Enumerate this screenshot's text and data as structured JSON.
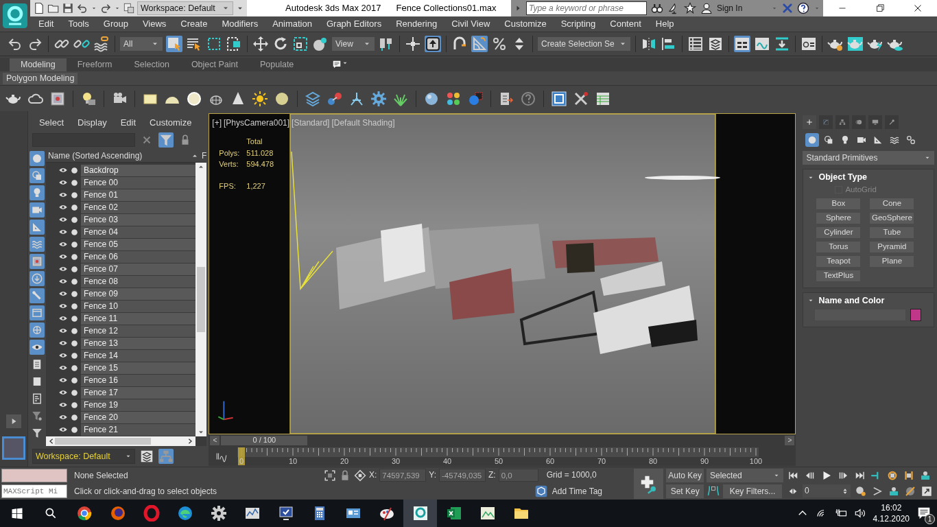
{
  "title_bar": {
    "workspace": "Workspace: Default",
    "app_title": "Autodesk 3ds Max 2017",
    "file_name": "Fence Collections01.max",
    "search": {
      "placeholder": "Type a keyword or phrase"
    },
    "sign_in": "Sign In"
  },
  "menu_bar": [
    "Edit",
    "Tools",
    "Group",
    "Views",
    "Create",
    "Modifiers",
    "Animation",
    "Graph Editors",
    "Rendering",
    "Civil View",
    "Customize",
    "Scripting",
    "Content",
    "Help"
  ],
  "main_toolbar": [
    {
      "kind": "button",
      "active": false
    },
    {
      "kind": "button",
      "active": false
    },
    {
      "kind": "button",
      "active": false
    },
    {
      "kind": "button",
      "active": false
    },
    {
      "kind": "button",
      "active": false
    },
    {
      "kind": "dropdown",
      "value": "All"
    },
    {
      "kind": "button",
      "active": true
    },
    {
      "kind": "button",
      "active": false
    },
    {
      "kind": "button",
      "active": false
    },
    {
      "kind": "button",
      "active": false
    },
    {
      "kind": "button",
      "active": false
    },
    {
      "kind": "button",
      "active": false
    },
    {
      "kind": "button",
      "active": false
    },
    {
      "kind": "button",
      "active": false
    },
    {
      "kind": "dropdown",
      "value": "View"
    },
    {
      "kind": "button",
      "active": false
    },
    {
      "kind": "button",
      "active": false
    },
    {
      "kind": "button",
      "active": true
    },
    {
      "kind": "button",
      "active": false
    },
    {
      "kind": "button",
      "active": true
    },
    {
      "kind": "button",
      "active": false
    },
    {
      "kind": "button",
      "active": false
    },
    {
      "kind": "dropdown",
      "value": "Create Selection Se"
    },
    {
      "kind": "button",
      "active": false
    },
    {
      "kind": "button",
      "active": false
    },
    {
      "kind": "button",
      "active": false
    },
    {
      "kind": "button",
      "active": false
    },
    {
      "kind": "button",
      "active": true
    },
    {
      "kind": "button",
      "active": false
    },
    {
      "kind": "button",
      "active": false
    },
    {
      "kind": "button",
      "active": false
    },
    {
      "kind": "button",
      "active": false
    },
    {
      "kind": "button",
      "active": false
    },
    {
      "kind": "button",
      "active": false
    },
    {
      "kind": "button",
      "active": false
    }
  ],
  "ribbon": {
    "tabs": [
      {
        "label": "Modeling",
        "selected": true
      },
      {
        "label": "Freeform",
        "selected": false
      },
      {
        "label": "Selection",
        "selected": false
      },
      {
        "label": "Object Paint",
        "selected": false
      },
      {
        "label": "Populate",
        "selected": false
      }
    ],
    "panel_label": "Polygon Modeling"
  },
  "scene_explorer": {
    "menu": [
      "Select",
      "Display",
      "Edit",
      "Customize"
    ],
    "filters": [
      {
        "active": true
      },
      {
        "active": true
      },
      {
        "active": true
      },
      {
        "active": true
      },
      {
        "active": true
      },
      {
        "active": true
      },
      {
        "active": true
      },
      {
        "active": true
      },
      {
        "active": true
      },
      {
        "active": true
      },
      {
        "active": true
      },
      {
        "active": true
      },
      {
        "active": false
      },
      {
        "active": false
      },
      {
        "active": false
      },
      {
        "active": false
      },
      {
        "active": false
      }
    ],
    "filter_toggle": {
      "active": true
    },
    "column": "Name (Sorted Ascending)",
    "column_2": "F",
    "items": [
      "Backdrop",
      "Fence 00",
      "Fence 01",
      "Fence 02",
      "Fence 03",
      "Fence 04",
      "Fence 05",
      "Fence 06",
      "Fence 07",
      "Fence 08",
      "Fence 09",
      "Fence 10",
      "Fence 11",
      "Fence 12",
      "Fence 13",
      "Fence 14",
      "Fence 15",
      "Fence 16",
      "Fence 17",
      "Fence 19",
      "Fence 20",
      "Fence 21"
    ],
    "workspace": "Workspace: Default",
    "view_buttons": [
      {
        "active": false
      },
      {
        "active": true
      }
    ]
  },
  "viewport": {
    "labels": [
      "[+]",
      "[PhysCamera001]",
      "[Standard]",
      "[Default Shading]"
    ],
    "stats_header": "Total",
    "stats": [
      {
        "label": "Polys:",
        "value": "511.028"
      },
      {
        "label": "Verts:",
        "value": "594.478"
      },
      {
        "label": "FPS:",
        "value": "1,227"
      }
    ]
  },
  "command_panel": {
    "tabs": [
      {
        "selected": true
      },
      {
        "selected": false
      },
      {
        "selected": false
      },
      {
        "selected": false
      },
      {
        "selected": false
      },
      {
        "selected": false
      }
    ],
    "categories": [
      {
        "selected": true
      },
      {
        "selected": false
      },
      {
        "selected": false
      },
      {
        "selected": false
      },
      {
        "selected": false
      },
      {
        "selected": false
      },
      {
        "selected": false
      }
    ],
    "dropdown": "Standard Primitives",
    "object_type": {
      "title": "Object Type",
      "autogrid": {
        "label": "AutoGrid",
        "checked": false,
        "disabled": true
      },
      "buttons": [
        "Box",
        "Cone",
        "Sphere",
        "GeoSphere",
        "Cylinder",
        "Tube",
        "Torus",
        "Pyramid",
        "Teapot",
        "Plane",
        "TextPlus"
      ]
    },
    "name_and_color": {
      "title": "Name and Color",
      "color": "#c0378a"
    }
  },
  "timeline": {
    "slider": {
      "prev": "<",
      "label": "0 / 100",
      "next": ">",
      "level": 0
    },
    "ticks": [
      "0",
      "10",
      "20",
      "30",
      "40",
      "50",
      "60",
      "70",
      "80",
      "90",
      "100"
    ]
  },
  "status_bar": {
    "script_field": {
      "placeholder": "MAXScript Mi"
    },
    "selection": "None Selected",
    "prompt": "Click or click-and-drag to select objects",
    "coords": [
      {
        "label": "X:",
        "value": "74597,539"
      },
      {
        "label": "Y:",
        "value": "-45749,035"
      },
      {
        "label": "Z:",
        "value": "0,0"
      }
    ],
    "grid": "Grid = 1000,0",
    "time_tag": "Add Time Tag",
    "auto_key": "Auto Key",
    "set_key": "Set Key",
    "key_mode": "Selected",
    "key_filters": "Key Filters...",
    "frame": "0"
  },
  "taskbar": {
    "apps": [
      {
        "active": false
      },
      {
        "active": false
      },
      {
        "active": false
      },
      {
        "active": false
      },
      {
        "active": false
      },
      {
        "active": false
      },
      {
        "active": false
      },
      {
        "active": false
      },
      {
        "active": false
      },
      {
        "active": false
      },
      {
        "active": true
      },
      {
        "active": false
      },
      {
        "active": false
      },
      {
        "active": false
      }
    ],
    "time": "16:02",
    "date": "4.12.2020",
    "notifications": "1"
  }
}
